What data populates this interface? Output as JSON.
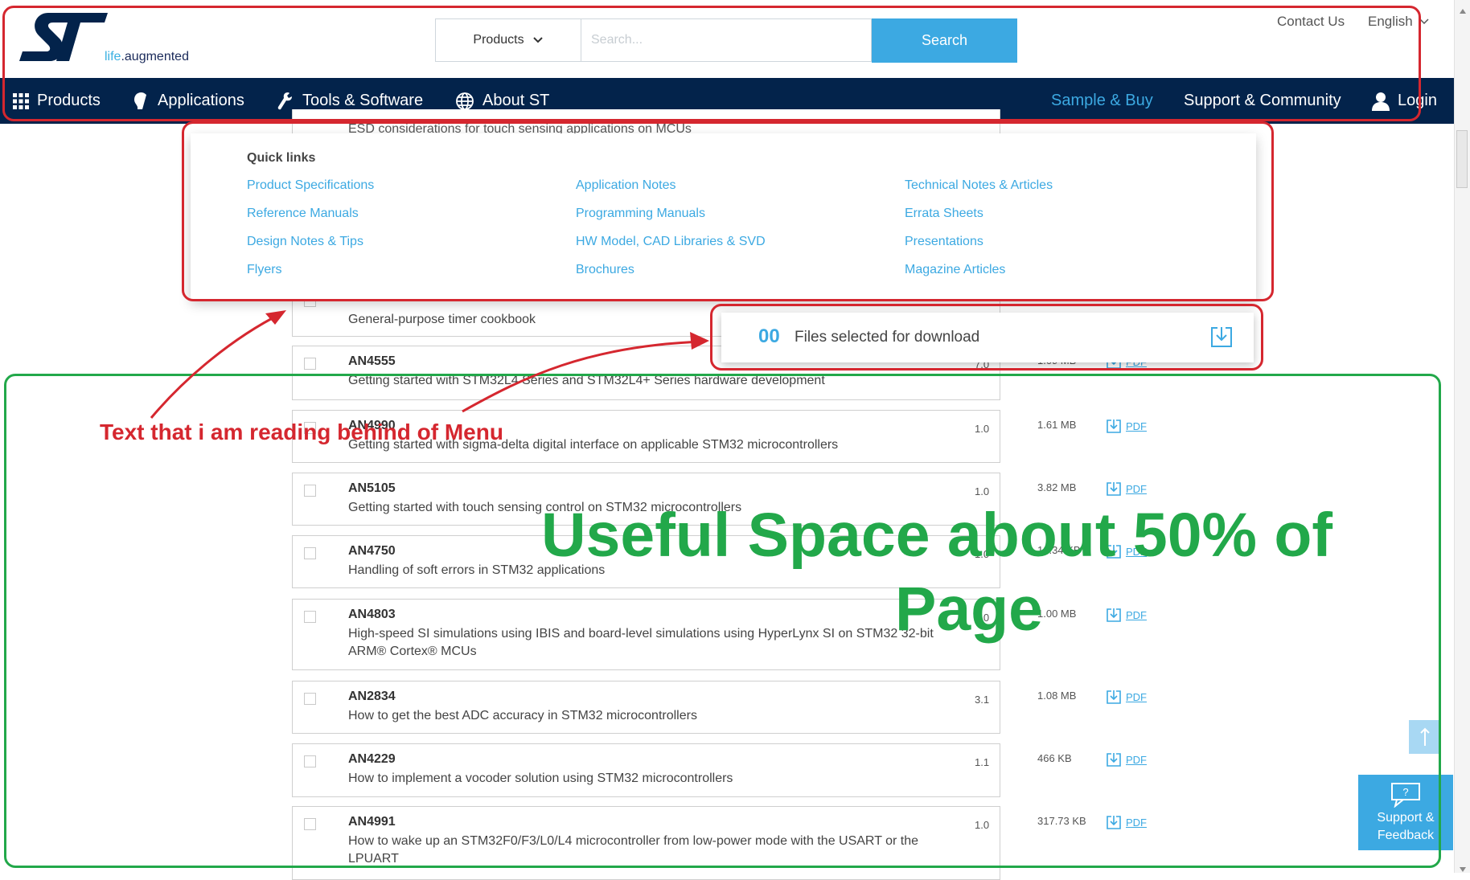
{
  "header": {
    "logo_tagline_a": "life",
    "logo_tagline_b": ".augmented",
    "product_select": "Products",
    "search_placeholder": "Search...",
    "search_button": "Search",
    "contact_us": "Contact Us",
    "language": "English"
  },
  "nav": {
    "products": "Products",
    "applications": "Applications",
    "tools": "Tools & Software",
    "about": "About ST",
    "sample_buy": "Sample & Buy",
    "support": "Support & Community",
    "login": "Login"
  },
  "hidden_row": {
    "title_partial": "ESD considerations for touch sensing applications on MCUs",
    "timer_title": "General-purpose timer cookbook"
  },
  "quick_links": {
    "heading": "Quick links",
    "col1": [
      "Product Specifications",
      "Reference Manuals",
      "Design Notes & Tips",
      "Flyers"
    ],
    "col2": [
      "Application Notes",
      "Programming Manuals",
      "HW Model, CAD Libraries & SVD",
      "Brochures"
    ],
    "col3": [
      "Technical Notes & Articles",
      "Errata Sheets",
      "Presentations",
      "Magazine Articles"
    ]
  },
  "files": {
    "count": "00",
    "label": "Files selected for download"
  },
  "documents": [
    {
      "code": "AN4555",
      "title": "Getting started with STM32L4 Series and STM32L4+ Series hardware development",
      "version": "7.0",
      "size": "1.09 MB",
      "pdf": "PDF"
    },
    {
      "code": "AN4990",
      "title": "Getting started with sigma-delta digital interface on applicable STM32 microcontrollers",
      "version": "1.0",
      "size": "1.61 MB",
      "pdf": "PDF"
    },
    {
      "code": "AN5105",
      "title": "Getting started with touch sensing control on STM32 microcontrollers",
      "version": "1.0",
      "size": "3.82 MB",
      "pdf": "PDF"
    },
    {
      "code": "AN4750",
      "title": "Handling of soft errors in STM32 applications",
      "version": "1.0",
      "size": "10.34 KB",
      "pdf": "PDF"
    },
    {
      "code": "AN4803",
      "title": "High-speed SI simulations using IBIS and board-level simulations using HyperLynx SI on STM32 32-bit ARM® Cortex® MCUs",
      "version": "1.0",
      "size": "1.00 MB",
      "pdf": "PDF"
    },
    {
      "code": "AN2834",
      "title": "How to get the best ADC accuracy in STM32 microcontrollers",
      "version": "3.1",
      "size": "1.08 MB",
      "pdf": "PDF"
    },
    {
      "code": "AN4229",
      "title": "How to implement a vocoder solution using STM32 microcontrollers",
      "version": "1.1",
      "size": "466 KB",
      "pdf": "PDF"
    },
    {
      "code": "AN4991",
      "title": "How to wake up an STM32F0/F3/L0/L4 microcontroller from low-power mode with the USART or the LPUART",
      "version": "1.0",
      "size": "317.73 KB",
      "pdf": "PDF"
    }
  ],
  "floating": {
    "support_line1": "Support &",
    "support_line2": "Feedback"
  },
  "annotations": {
    "red_text": "Text that i am reading behind of Menu",
    "green_text_1": "Useful Space about 50% of",
    "green_text_2": "Page",
    "red_color": "#d5272f",
    "green_color": "#22a84a"
  },
  "colors": {
    "nav_bg": "#03234b",
    "accent": "#3ca9e2"
  }
}
